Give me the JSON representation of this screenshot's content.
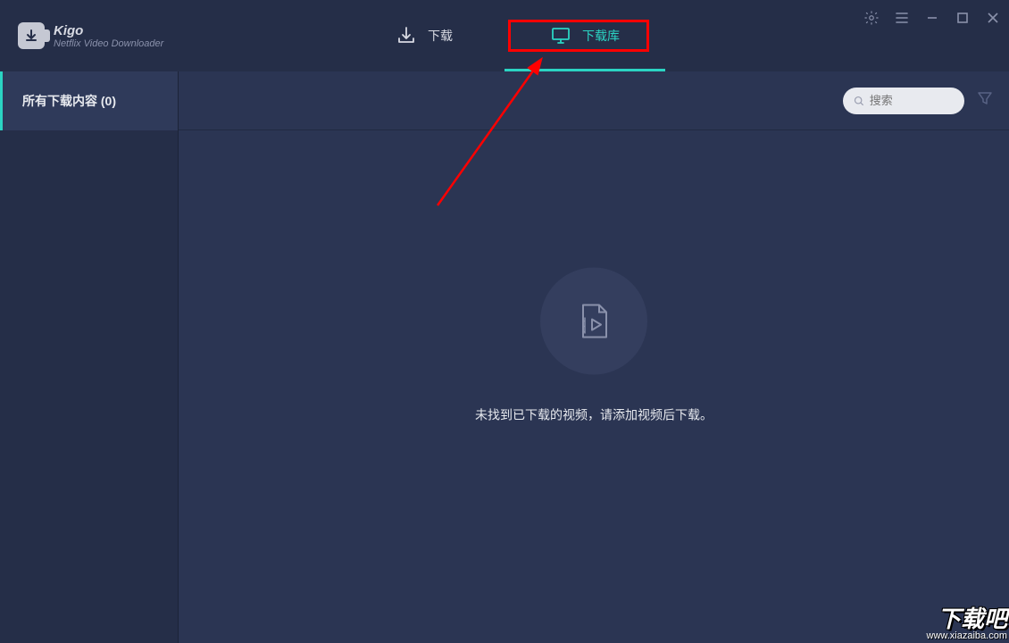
{
  "app": {
    "title": "Kigo",
    "subtitle": "Netflix Video Downloader"
  },
  "tabs": {
    "download": "下载",
    "library": "下载库"
  },
  "sidebar": {
    "all_downloads": "所有下载内容 (0)"
  },
  "search": {
    "placeholder": "搜索"
  },
  "empty": {
    "message": "未找到已下载的视频，请添加视频后下载。"
  },
  "watermark": {
    "main": "下载吧",
    "sub": "www.xiazaiba.com"
  }
}
